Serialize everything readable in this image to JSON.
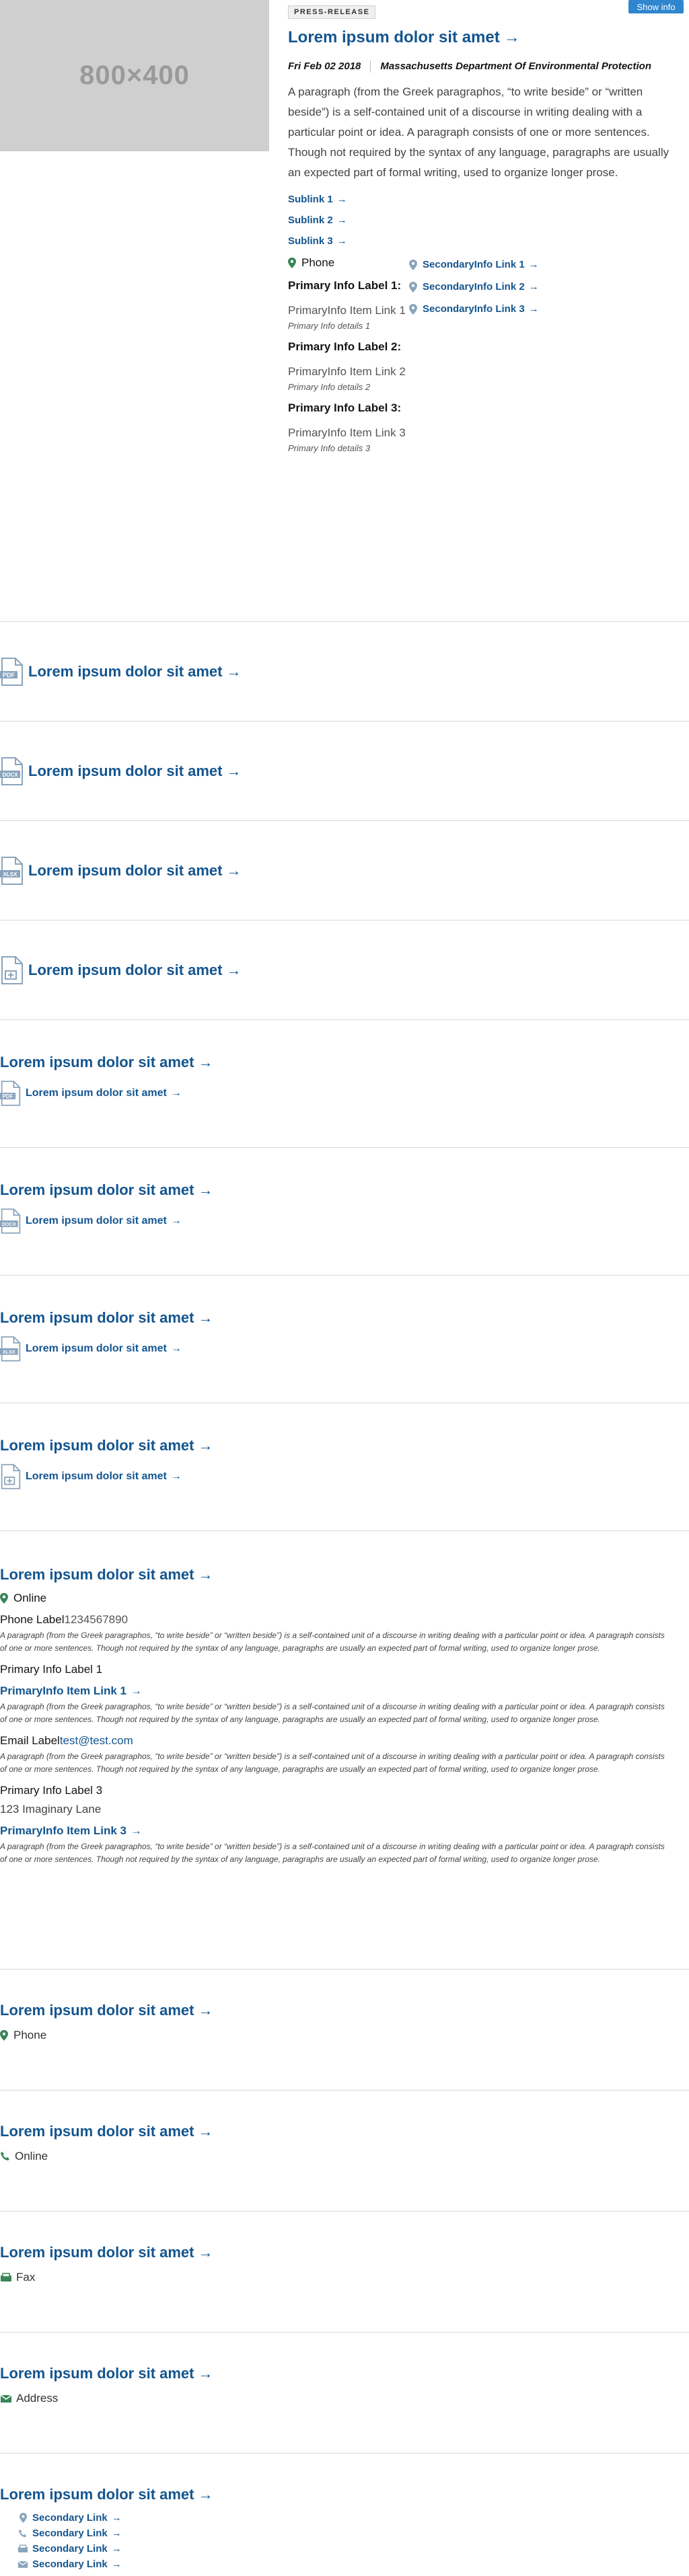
{
  "top": {
    "placeholder": "800×400",
    "show_info": "Show info",
    "tag": "PRESS-RELEASE",
    "title": "Lorem ipsum dolor sit amet",
    "date": "Fri Feb 02 2018",
    "org": "Massachusetts Department Of Environmental Protection",
    "paragraph": "A paragraph (from the Greek paragraphos, “to write beside” or “written beside”) is a self-contained unit of a discourse in writing dealing with a particular point or idea. A paragraph consists of one or more sentences. Though not required by the syntax of any language, paragraphs are usually an expected part of formal writing, used to organize longer prose.",
    "sublinks": [
      "Sublink 1",
      "Sublink 2",
      "Sublink 3"
    ],
    "phone_label": "Phone",
    "primary": [
      {
        "label": "Primary Info Label 1:",
        "item": "PrimaryInfo Item Link 1",
        "details": "Primary Info details 1"
      },
      {
        "label": "Primary Info Label 2:",
        "item": "PrimaryInfo Item Link 2",
        "details": "Primary Info details 2"
      },
      {
        "label": "Primary Info Label 3:",
        "item": "PrimaryInfo Item Link 3",
        "details": "Primary Info details 3"
      }
    ],
    "secondary": [
      "SecondaryInfo Link 1",
      "SecondaryInfo Link 2",
      "SecondaryInfo Link 3"
    ]
  },
  "doc_rows": [
    {
      "title": "Lorem ipsum dolor sit amet",
      "icon": "PDF"
    },
    {
      "title": "Lorem ipsum dolor sit amet",
      "icon": "DOCX"
    },
    {
      "title": "Lorem ipsum dolor sit amet",
      "icon": "XLSX"
    },
    {
      "title": "Lorem ipsum dolor sit amet",
      "icon": "GENERIC"
    }
  ],
  "sub_rows": [
    {
      "title": "Lorem ipsum dolor sit amet",
      "sub": "Lorem ipsum dolor sit amet",
      "icon": "PDF"
    },
    {
      "title": "Lorem ipsum dolor sit amet",
      "sub": "Lorem ipsum dolor sit amet",
      "icon": "DOCX"
    },
    {
      "title": "Lorem ipsum dolor sit amet",
      "sub": "Lorem ipsum dolor sit amet",
      "icon": "XLSX"
    },
    {
      "title": "Lorem ipsum dolor sit amet",
      "sub": "Lorem ipsum dolor sit amet",
      "icon": "GENERIC"
    }
  ],
  "detail": {
    "title": "Lorem ipsum dolor sit amet",
    "online": "Online",
    "phone_label": "Phone Label",
    "phone_value": "1234567890",
    "para": "A paragraph (from the Greek paragraphos, “to write beside” or “written beside”) is a self-contained unit of a discourse in writing dealing with a particular point or idea. A paragraph consists of one or more sentences. Though not required by the syntax of any language, paragraphs are usually an expected part of formal writing, used to organize longer prose.",
    "pil1": "Primary Info Label 1",
    "link1": "PrimaryInfo Item Link 1",
    "email_label": "Email Label",
    "email_value": "test@test.com",
    "pil3": "Primary Info Label 3",
    "address": "123 Imaginary Lane",
    "link3": "PrimaryInfo Item Link 3"
  },
  "contacts": [
    {
      "title": "Lorem ipsum dolor sit amet",
      "label": "Phone",
      "icon": "map-pin-icon"
    },
    {
      "title": "Lorem ipsum dolor sit amet",
      "label": "Online",
      "icon": "phone-icon"
    },
    {
      "title": "Lorem ipsum dolor sit amet",
      "label": "Fax",
      "icon": "fax-icon"
    },
    {
      "title": "Lorem ipsum dolor sit amet",
      "label": "Address",
      "icon": "envelope-icon"
    }
  ],
  "last": {
    "title": "Lorem ipsum dolor sit amet",
    "links": [
      {
        "label": "Secondary Link",
        "icon": "map-pin-icon"
      },
      {
        "label": "Secondary Link",
        "icon": "phone-icon"
      },
      {
        "label": "Secondary Link",
        "icon": "fax-icon"
      },
      {
        "label": "Secondary Link",
        "icon": "envelope-icon"
      }
    ]
  },
  "colors": {
    "link": "#14558f",
    "button": "#2f86cf",
    "pin": "#388557"
  }
}
